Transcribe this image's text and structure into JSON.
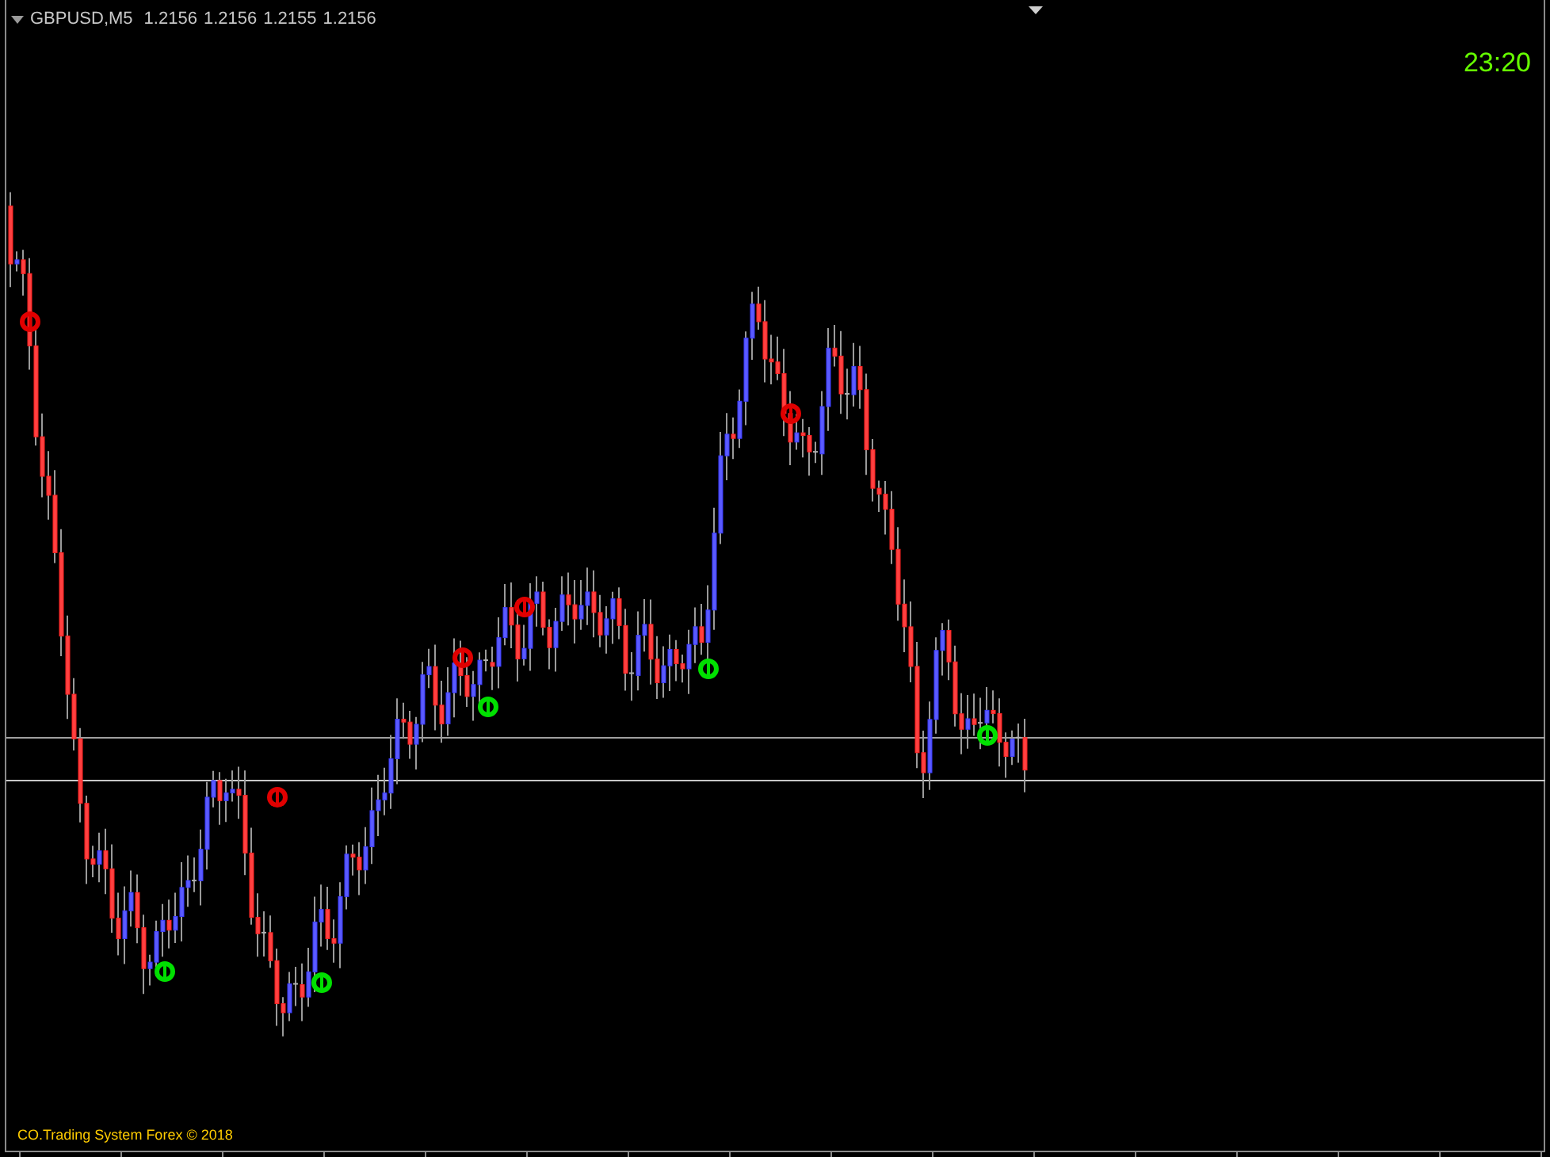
{
  "chart": {
    "symbol": "GBPUSD,M5",
    "quotes": [
      "1.2156",
      "1.2156",
      "1.2155",
      "1.2156"
    ],
    "clock": "23:20",
    "footer": "CO.Trading System Forex © 2018"
  }
}
